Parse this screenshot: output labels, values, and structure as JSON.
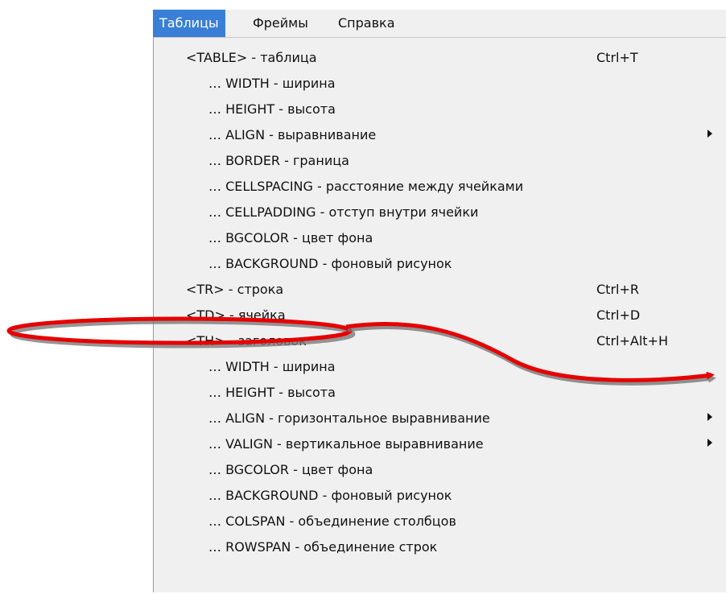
{
  "menubar": {
    "items": [
      {
        "label": "Таблицы"
      },
      {
        "label": "Фреймы"
      },
      {
        "label": "Справка"
      }
    ]
  },
  "menu": {
    "items": [
      {
        "label": "<TABLE> - таблица",
        "shortcut": "Ctrl+T"
      },
      {
        "label": "… WIDTH - ширина"
      },
      {
        "label": "… HEIGHT - высота"
      },
      {
        "label": "… ALIGN - выравнивание",
        "submenu": true
      },
      {
        "label": "… BORDER - граница"
      },
      {
        "label": "… CELLSPACING - расстояние между ячейками"
      },
      {
        "label": "… CELLPADDING - отступ внутри ячейки"
      },
      {
        "label": "… BGCOLOR - цвет фона"
      },
      {
        "label": "… BACKGROUND - фоновый рисунок"
      },
      {
        "label": "<TR> - строка",
        "shortcut": "Ctrl+R"
      },
      {
        "label": "<TD> - ячейка",
        "shortcut": "Ctrl+D"
      },
      {
        "label": "<TH> - заголовок",
        "shortcut": "Ctrl+Alt+H"
      },
      {
        "label": "… WIDTH - ширина"
      },
      {
        "label": "… HEIGHT - высота"
      },
      {
        "label": "… ALIGN - горизонтальное выравнивание",
        "submenu": true
      },
      {
        "label": "… VALIGN - вертикальное выравнивание",
        "submenu": true
      },
      {
        "label": "… BGCOLOR - цвет фона"
      },
      {
        "label": "… BACKGROUND - фоновый рисунок"
      },
      {
        "label": "… COLSPAN - объединение столбцов"
      },
      {
        "label": "… ROWSPAN - объединение строк"
      }
    ]
  },
  "colors": {
    "menu_bg": "#f0f0f0",
    "active_menu_bg": "#3a7fd6",
    "annotation": "#e60000",
    "annotation_shadow": "#777777"
  }
}
